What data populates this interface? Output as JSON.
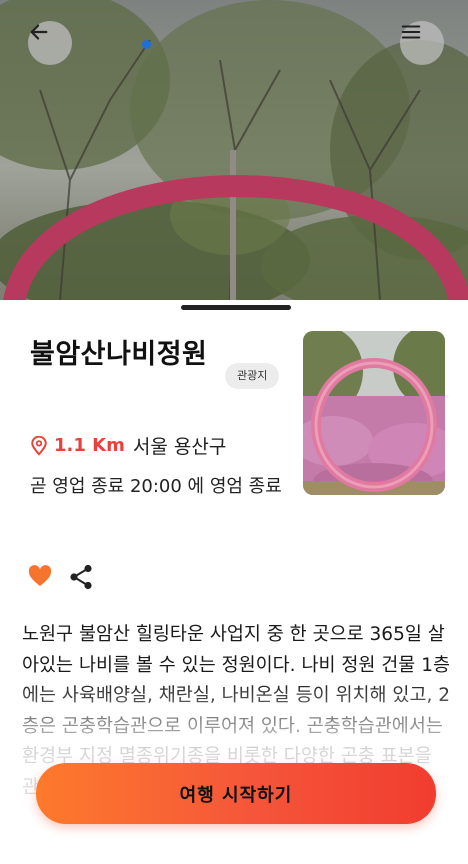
{
  "place": {
    "name": "불암산나비정원",
    "category_badge": "관광지",
    "distance": "1.1 Km",
    "address": "서울 용산구",
    "hours_text": "곧 영업 종료 20:00 에 영엄 종료",
    "description": "노원구 불암산 힐링타운 사업지 중 한 곳으로 365일 살아있는 나비를 볼 수 있는 정원이다. 나비 정원 건물 1층에는 사육배양실, 채란실, 나비온실 등이 위치해 있고, 2층은 곤충학습관으로 이루어져 있다. 곤충학습관에서는 환경부 지정 멸종위기종을 비롯한 다양한 곤충 표본을 관찰할 수 있다. 자세 관람 시 체험이 필요하다"
  },
  "actions": {
    "start_trip_label": "여행 시작하기"
  },
  "icons": {
    "back": "arrow-left-icon",
    "menu": "hamburger-menu-icon",
    "location": "location-pin-icon",
    "favorite": "heart-icon",
    "share": "share-icon"
  },
  "colors": {
    "accent": "#e8433a",
    "cta_start": "#fd7a2b",
    "cta_end": "#f13c2f",
    "heart": "#f5752f",
    "page_indicator": "#1f6fd6"
  },
  "gallery": {
    "active_index": 1
  }
}
